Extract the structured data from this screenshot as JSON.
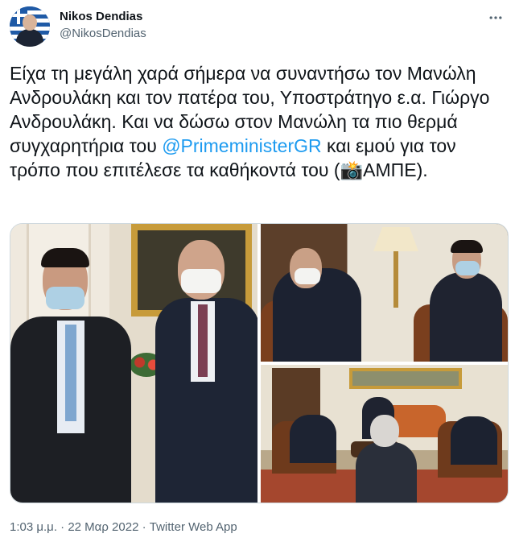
{
  "author": {
    "display_name": "Nikos Dendias",
    "handle": "@NikosDendias"
  },
  "more_icon": "more-horizontal-icon",
  "tweet": {
    "text_part1": "Είχα τη μεγάλη χαρά σήμερα να συναντήσω τον Μανώλη Ανδρουλάκη και τον πατέρα του, Υποστράτηγο ε.α. Γιώργο Ανδρουλάκη. Και να δώσω στον Μανώλη τα πιο θερμά συγχαρητήρια του ",
    "mention": "@PrimeministerGR",
    "text_part2": " και εμού για τον τρόπο που επιτέλεσε τα καθήκοντά του (📸ΑΜΠΕ).",
    "mention_color": "#1d9bf0"
  },
  "media": {
    "photo_count": 3
  },
  "meta": {
    "time": "1:03 μ.μ.",
    "separator1": " · ",
    "date": "22 Μαρ 2022",
    "separator2": " · ",
    "source": "Twitter Web App"
  }
}
